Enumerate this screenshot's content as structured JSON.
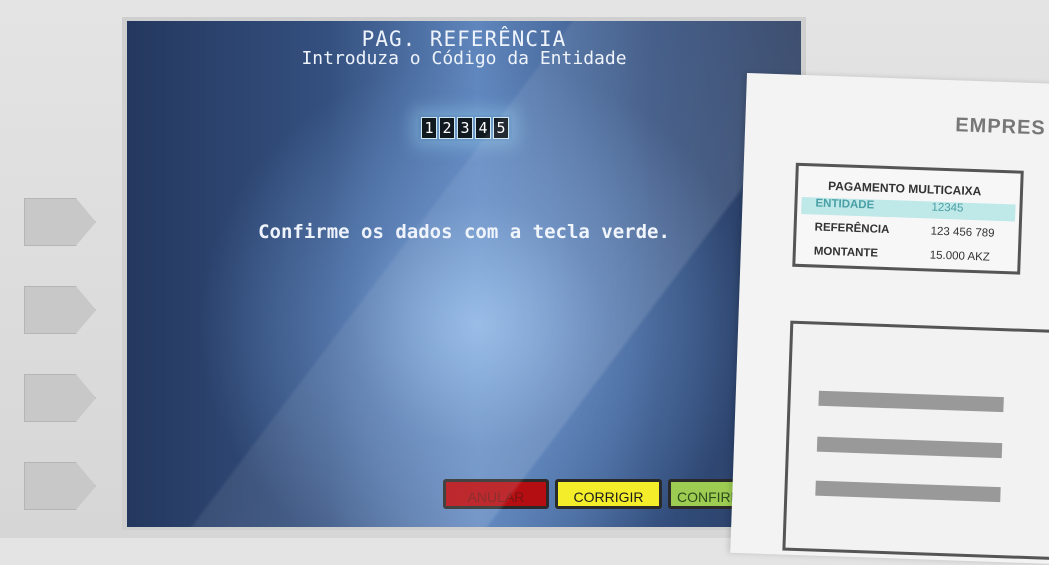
{
  "screen": {
    "title": "PAG. REFERÊNCIA",
    "subtitle": "Introduza o Código da Entidade",
    "entity_code_digits": [
      "1",
      "2",
      "3",
      "4",
      "5"
    ],
    "message": "Confirme os dados com a tecla verde."
  },
  "buttons": {
    "cancel": "ANULAR",
    "correct": "CORRIGIR",
    "confirm": "CONFIRM"
  },
  "receipt": {
    "company": "EMPRES",
    "payment_title": "PAGAMENTO MULTICAIXA",
    "rows": [
      {
        "label": "ENTIDADE",
        "value": "12345"
      },
      {
        "label": "REFERÊNCIA",
        "value": "123 456 789"
      },
      {
        "label": "MONTANTE",
        "value": "15.000 AKZ"
      }
    ]
  },
  "colors": {
    "cancel": "#b40d12",
    "correct": "#f4ee2a",
    "confirm": "#9ccc52",
    "highlight": "#bfe8e8"
  }
}
